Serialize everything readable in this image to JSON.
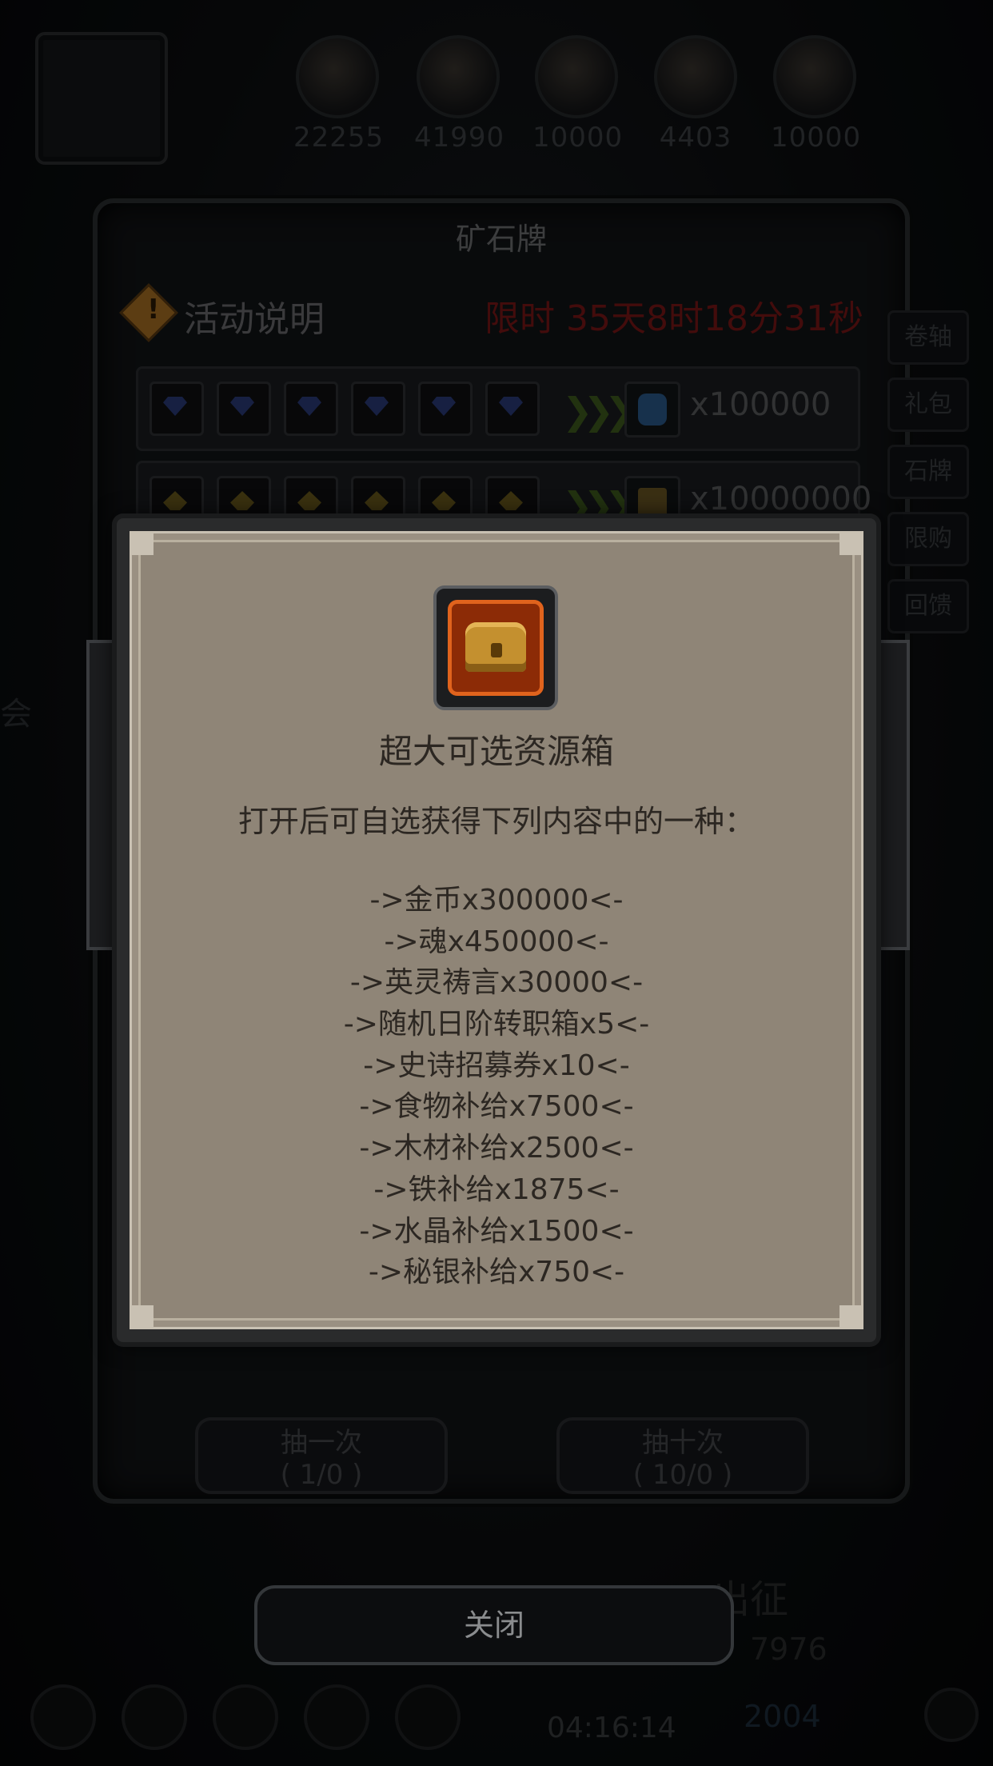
{
  "resources": [
    {
      "icon": "bread-resource-icon",
      "value": "22255"
    },
    {
      "icon": "wood-resource-icon",
      "value": "41990"
    },
    {
      "icon": "iron-resource-icon",
      "value": "10000"
    },
    {
      "icon": "crystal-resource-icon",
      "value": "4403"
    },
    {
      "icon": "mithril-resource-icon",
      "value": "10000"
    }
  ],
  "panel": {
    "title": "矿石牌",
    "info_label": "活动说明",
    "timer": "限时 35天8时18分31秒"
  },
  "reward_rows": [
    {
      "gem": "blue-gem",
      "reward_qty": "x100000"
    },
    {
      "gem": "gold-ore",
      "reward_qty": "x10000000"
    }
  ],
  "side_tabs": [
    "卷轴",
    "礼包",
    "石牌",
    "限购",
    "回馈"
  ],
  "draw_buttons": {
    "once_label": "抽一次",
    "once_count": "( 1/0 )",
    "ten_label": "抽十次",
    "ten_count": "( 10/0 )"
  },
  "close_label": "关闭",
  "background": {
    "left_edge_text": "会",
    "expedition_label": "出征",
    "value_1": "7976",
    "value_2": "2004",
    "countdown": "04:16:14"
  },
  "popup": {
    "item_icon": "treasure-chest-icon",
    "title": "超大可选资源箱",
    "description": "打开后可自选获得下列内容中的一种：",
    "options": [
      "->金币x300000<-",
      "->魂x450000<-",
      "->英灵祷言x30000<-",
      "->随机日阶转职箱x5<-",
      "->史诗招募券x10<-",
      "->食物补给x7500<-",
      "->木材补给x2500<-",
      "->铁补给x1875<-",
      "->水晶补给x1500<-",
      "->秘银补给x750<-"
    ]
  },
  "colors": {
    "timer": "#7a1616",
    "popup_bg": "#8f8577",
    "item_frame": "#e0631d"
  }
}
